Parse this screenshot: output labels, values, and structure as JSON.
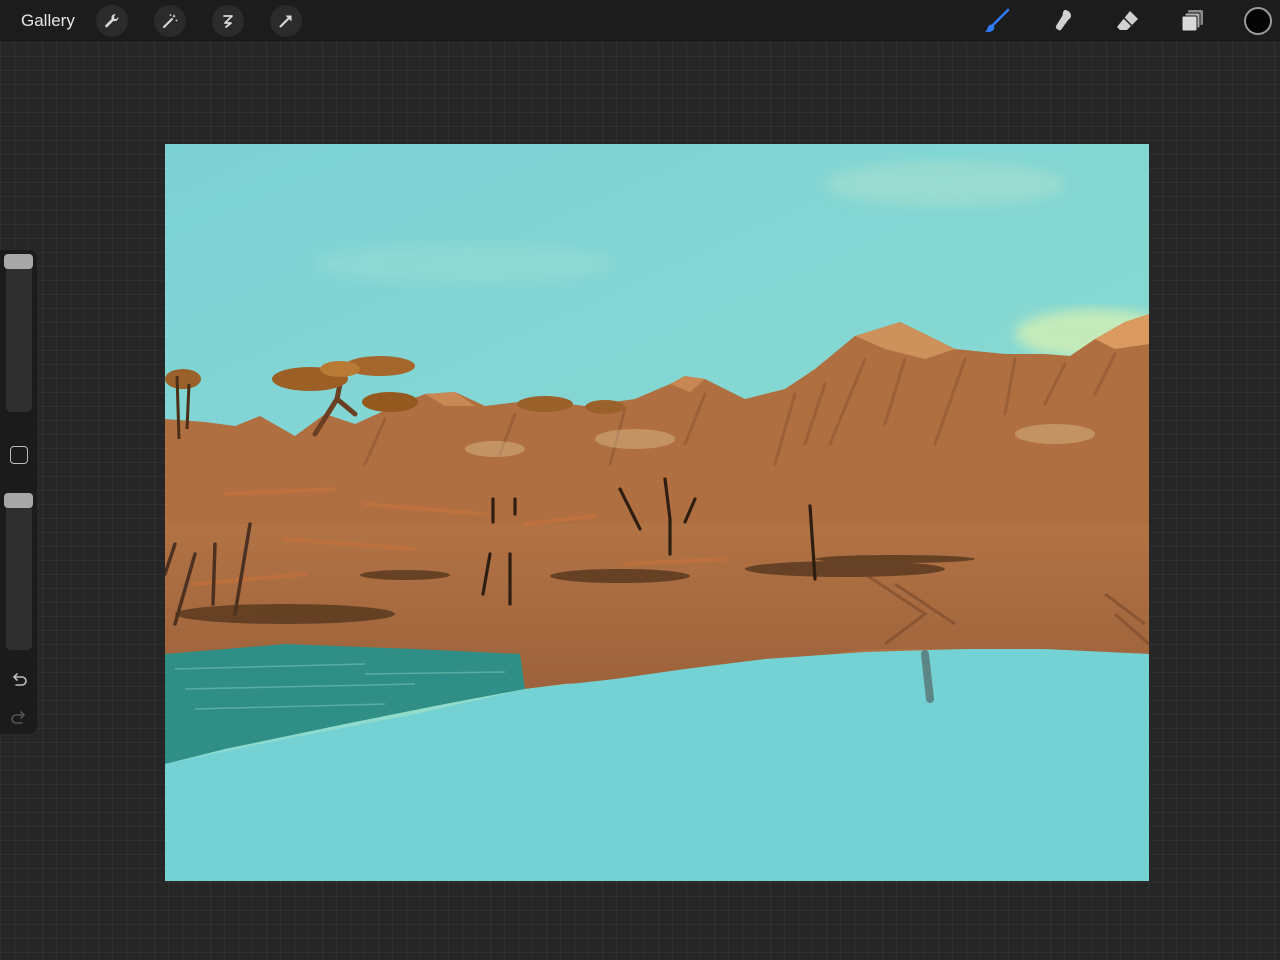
{
  "toolbar": {
    "gallery_label": "Gallery",
    "left_tools": [
      "wrench-icon",
      "magic-wand-icon",
      "selection-icon",
      "transform-arrow-icon"
    ],
    "right_tools": [
      "brush-icon",
      "smudge-icon",
      "eraser-icon",
      "layers-icon"
    ],
    "active_tool": "brush",
    "active_color": "#050505",
    "accent_color": "#2f7bff"
  },
  "sidebar": {
    "brush_size_level": 0.05,
    "opacity_level": 0.05,
    "buttons": [
      "modify-button",
      "undo-button",
      "redo-button"
    ]
  },
  "artwork": {
    "sky_color": "#7dd4d6",
    "land_color": "#a66a3e",
    "water_color": "#74d2d4",
    "shallow_water_color": "#2f8f86"
  }
}
